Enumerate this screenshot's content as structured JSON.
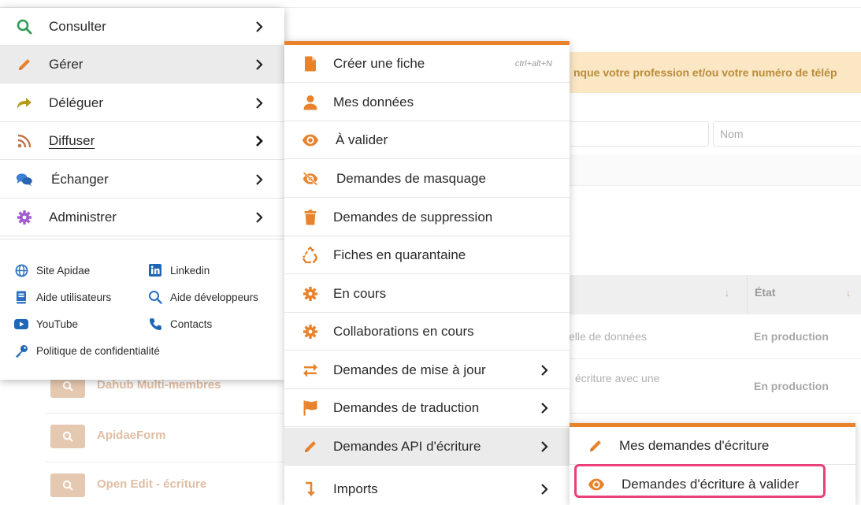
{
  "background": {
    "banner_text": "nque votre profession et/ou votre numéro de télép",
    "input_nom_placeholder": "Nom",
    "table_header_etat": "État",
    "rows": [
      {
        "description": "elle de données",
        "etat": "En production"
      },
      {
        "description": "écriture avec une",
        "etat": "En production"
      }
    ],
    "list_items": [
      "Dahub Multi-membres",
      "ApidaeForm",
      "Open Edit - écriture"
    ]
  },
  "main_menu": {
    "items": [
      {
        "label": "Consulter",
        "icon": "search-icon"
      },
      {
        "label": "Gérer",
        "icon": "pencil-icon"
      },
      {
        "label": "Déléguer",
        "icon": "share-arrow-icon"
      },
      {
        "label": "Diffuser",
        "icon": "rss-icon"
      },
      {
        "label": "Échanger",
        "icon": "chat-bubbles-icon"
      },
      {
        "label": "Administrer",
        "icon": "gear-icon"
      }
    ],
    "links": [
      {
        "label": "Site Apidae",
        "icon": "globe-icon"
      },
      {
        "label": "Linkedin",
        "icon": "linkedin-icon"
      },
      {
        "label": "Aide utilisateurs",
        "icon": "book-icon"
      },
      {
        "label": "Aide développeurs",
        "icon": "search-icon"
      },
      {
        "label": "YouTube",
        "icon": "youtube-icon"
      },
      {
        "label": "Contacts",
        "icon": "phone-icon"
      },
      {
        "label": "Politique de confidentialité",
        "icon": "key-icon"
      }
    ]
  },
  "sub_menu": {
    "items": [
      {
        "label": "Créer une fiche",
        "shortcut": "ctrl+alt+N",
        "icon": "file-icon"
      },
      {
        "label": "Mes données",
        "icon": "user-icon"
      },
      {
        "label": "À valider",
        "icon": "eye-icon"
      },
      {
        "label": "Demandes de masquage",
        "icon": "eye-slash-icon"
      },
      {
        "label": "Demandes de suppression",
        "icon": "trash-icon"
      },
      {
        "label": "Fiches en quarantaine",
        "icon": "recycle-icon"
      },
      {
        "label": "En cours",
        "icon": "gear-icon"
      },
      {
        "label": "Collaborations en cours",
        "icon": "gear-icon"
      },
      {
        "label": "Demandes de mise à jour",
        "icon": "exchange-icon"
      },
      {
        "label": "Demandes de traduction",
        "icon": "flag-icon"
      },
      {
        "label": "Demandes API d'écriture",
        "icon": "pencil-icon"
      },
      {
        "label": "Imports",
        "icon": "level-down-icon"
      }
    ]
  },
  "sub2_menu": {
    "items": [
      {
        "label": "Mes demandes d'écriture",
        "icon": "pencil-icon"
      },
      {
        "label": "Demandes d'écriture à valider",
        "icon": "eye-icon"
      }
    ]
  },
  "colors": {
    "accent_orange": "#e8822b",
    "highlight_pink": "#e9407a",
    "banner_bg": "#fbe7c4"
  }
}
